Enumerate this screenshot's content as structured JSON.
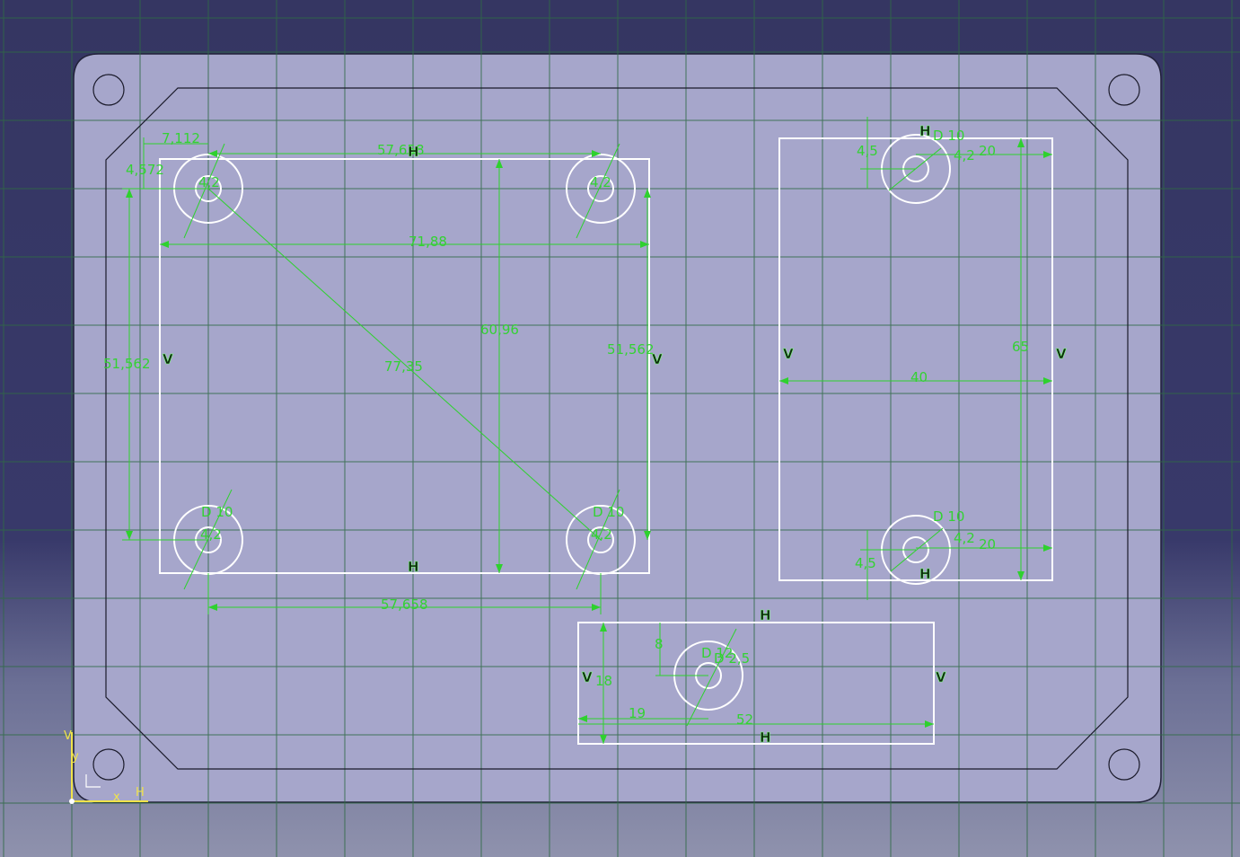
{
  "sketch": {
    "dimensions": {
      "top_left_x": "7,112",
      "top_left_y": "4,572",
      "top_span": "57,658",
      "plate_width": "71,88",
      "plate_height": "60,96",
      "left_height": "51,562",
      "right_height": "51,562",
      "diagonal": "77,35",
      "bottom_span": "57,658",
      "hole_dia_small": "4,2",
      "hole_dia_large": "D 10",
      "right_top_offset": "4,5",
      "right_top_x": "20",
      "right_height_65": "65",
      "right_width_40": "40",
      "right_bottom_offset": "4,5",
      "right_bottom_x": "20",
      "bottom_rect_8": "8",
      "bottom_rect_18": "18",
      "bottom_rect_19": "19",
      "bottom_rect_52": "52",
      "bottom_hole_large": "D 12",
      "bottom_hole_small": "D 2,5"
    },
    "constraints": {
      "horizontal": "H",
      "vertical": "V"
    },
    "axis": {
      "x": "x",
      "y": "y",
      "h": "H",
      "v": "V"
    }
  }
}
